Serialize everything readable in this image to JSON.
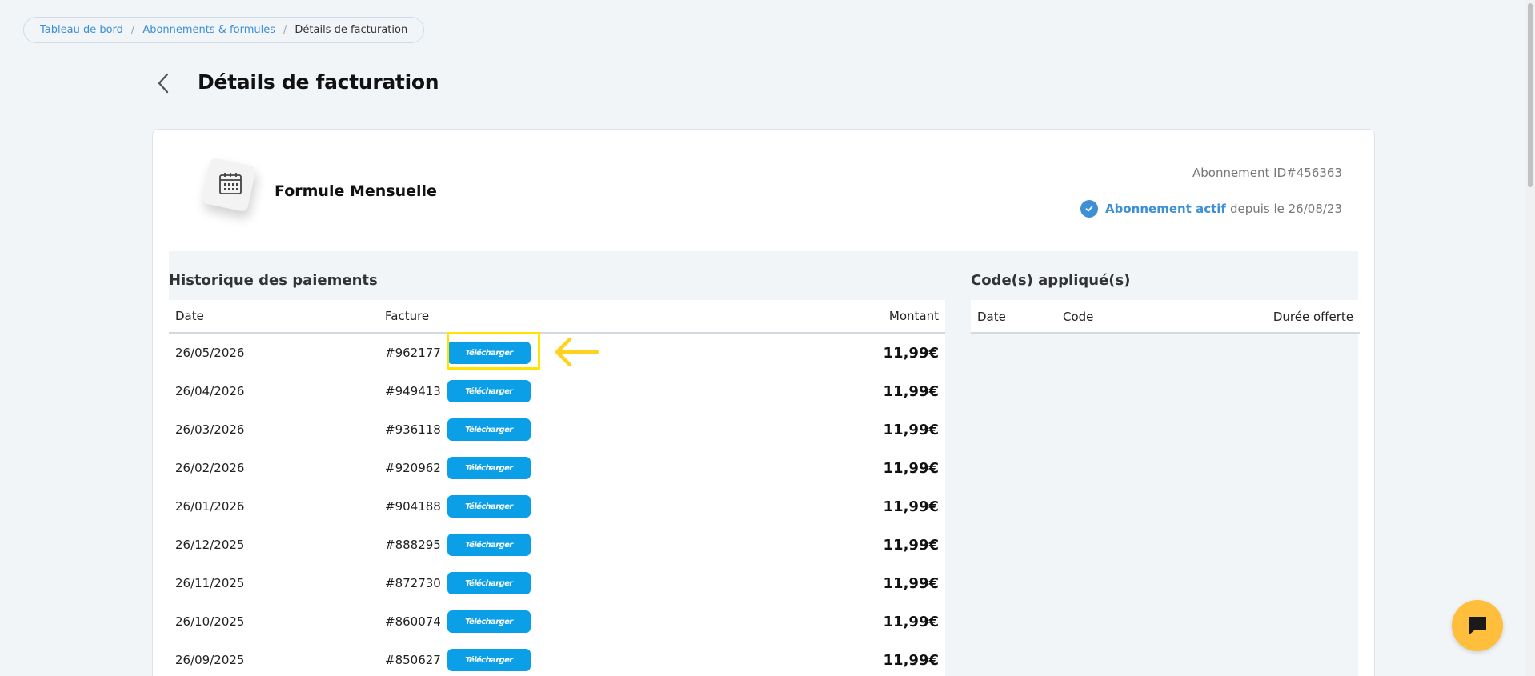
{
  "breadcrumb": {
    "items": [
      "Tableau de bord",
      "Abonnements & formules"
    ],
    "current": "Détails de facturation"
  },
  "page": {
    "title": "Détails de facturation"
  },
  "subscription": {
    "plan_name": "Formule Mensuelle",
    "id_label": "Abonnement ID#456363",
    "status_label": "Abonnement actif",
    "since_label": "depuis le 26/08/23"
  },
  "payments": {
    "title": "Historique des paiements",
    "columns": {
      "date": "Date",
      "invoice": "Facture",
      "amount": "Montant"
    },
    "download_label": "Télécharger",
    "rows": [
      {
        "date": "26/05/2026",
        "invoice": "#962177",
        "amount": "11,99€"
      },
      {
        "date": "26/04/2026",
        "invoice": "#949413",
        "amount": "11,99€"
      },
      {
        "date": "26/03/2026",
        "invoice": "#936118",
        "amount": "11,99€"
      },
      {
        "date": "26/02/2026",
        "invoice": "#920962",
        "amount": "11,99€"
      },
      {
        "date": "26/01/2026",
        "invoice": "#904188",
        "amount": "11,99€"
      },
      {
        "date": "26/12/2025",
        "invoice": "#888295",
        "amount": "11,99€"
      },
      {
        "date": "26/11/2025",
        "invoice": "#872730",
        "amount": "11,99€"
      },
      {
        "date": "26/10/2025",
        "invoice": "#860074",
        "amount": "11,99€"
      },
      {
        "date": "26/09/2025",
        "invoice": "#850627",
        "amount": "11,99€"
      }
    ]
  },
  "codes": {
    "title": "Code(s) appliqué(s)",
    "columns": {
      "date": "Date",
      "code": "Code",
      "duration": "Durée offerte"
    }
  },
  "icons": {
    "back": "chevron-left-icon",
    "plan": "calendar-icon",
    "status": "check-circle-icon",
    "annotation": "arrow-left-icon",
    "chat": "chat-bubble-icon"
  },
  "colors": {
    "accent": "#3d8fd6",
    "download_button": "#0a9fe6",
    "highlight": "#ffe400",
    "chat_button": "#ffbe3b"
  }
}
